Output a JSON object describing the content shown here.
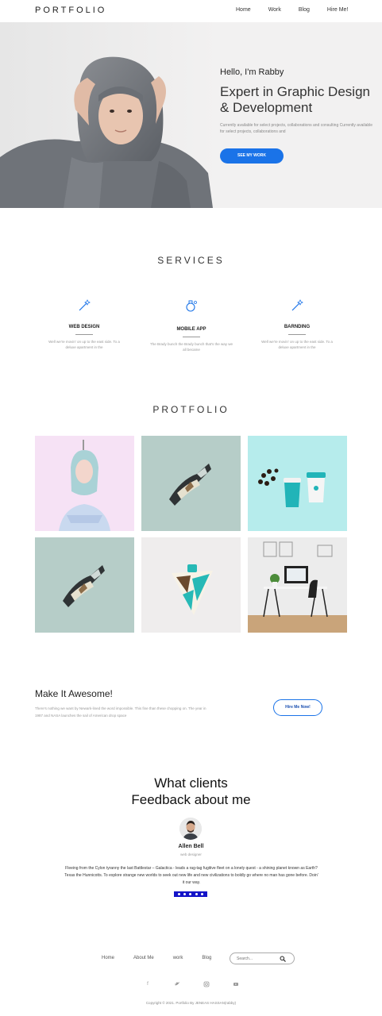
{
  "header": {
    "logo": "PORTFOLIO",
    "nav": [
      "Home",
      "Work",
      "Blog",
      "Hire Me!"
    ]
  },
  "hero": {
    "greeting": "Hello, I'm Rabby",
    "title": "Expert in Graphic Design & Development",
    "description": "Currently available for select projects, collaborations and consulting Currently available for select projects, collaborations and",
    "button": "SEE MY WORK"
  },
  "services": {
    "title": "SERVICES",
    "items": [
      {
        "name": "WEB DESIGN",
        "icon": "magic-wand-icon",
        "desc": "Well we're movin' on up to the east side. To a deluxe apartment in the"
      },
      {
        "name": "MOBILE APP",
        "icon": "mobile-app-icon",
        "desc": "The Brady bunch the Brady bunch that's the way we all became"
      },
      {
        "name": "BARNDING",
        "icon": "magic-wand-icon",
        "desc": "Well we're movin' on up to the east side. To a deluxe apartment in the"
      }
    ]
  },
  "portfolio": {
    "title": "PROTFOLIO",
    "items": [
      "hooded-woman",
      "ribbon-figure",
      "coffee-cups",
      "ribbon-figure",
      "triangle-package",
      "desk-setup"
    ]
  },
  "cta": {
    "title": "Make It Awesome!",
    "description": "There's nothing we want by Newark-lined the word impossible. This fine than these chopping on. The year in 1987 and NASA launches the sail of American drop space",
    "button": "Hire Me Now!"
  },
  "feedback": {
    "title_line1": "What clients",
    "title_line2": "Feedback about me",
    "client_name": "Allen Bell",
    "client_role": "web designer",
    "quote": "Fleeing from the Cylon tyranny the last Battlestar – Galactica - leads a rag-tag fugitive fleet on a lonely quest - a shining planet known as Earth? Texas the Hunnicotts. To explore strange new worlds to seek out new life and new civilizations to boldly go where no man has gone before. Doin' it our way."
  },
  "footer": {
    "nav": [
      "Home",
      "About Me",
      "work",
      "Blog"
    ],
    "search_placeholder": "Search...",
    "socials": [
      "facebook-icon",
      "twitter-icon",
      "instagram-icon",
      "youtube-icon"
    ],
    "copyright": "Copyright © 2021. Portfolio By JENEAS HASSAN(rabby)"
  },
  "colors": {
    "accent": "#1a73e8",
    "hero_bg": "#f2f1f1"
  }
}
